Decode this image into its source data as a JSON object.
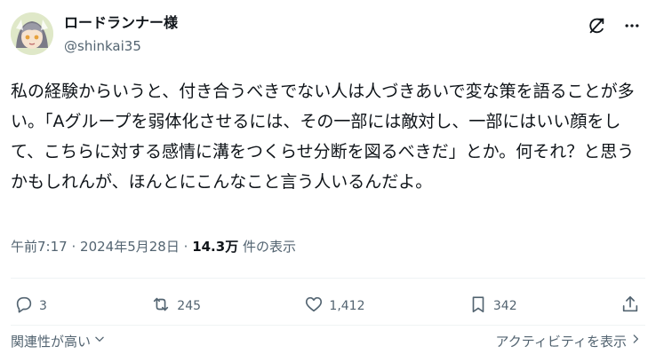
{
  "author": {
    "display_name": "ロードランナー様",
    "handle": "@shinkai35"
  },
  "icons": {
    "top_actions": [
      "grok-icon",
      "more-icon"
    ],
    "actions": [
      "reply-icon",
      "repost-icon",
      "like-icon",
      "bookmark-icon",
      "share-icon"
    ]
  },
  "post": {
    "text": "私の経験からいうと、付き合うべきでない人は人づきあいで変な策を語ることが多い。「Aグループを弱体化させるには、その一部には敵対し、一部にはいい顔をして、こちらに対する感情に溝をつくらせ分断を図るべきだ」とか。何それ？と思うかもしれんが、ほんとにこんなこと言う人いるんだよ。"
  },
  "meta": {
    "time": "午前7:17",
    "separator": "·",
    "date": "2024年5月28日",
    "views_count": "14.3万",
    "views_label": "件の表示"
  },
  "actions": {
    "replies": "3",
    "reposts": "245",
    "likes": "1,412",
    "bookmarks": "342"
  },
  "footer": {
    "sort_label": "関連性が高い",
    "activity_label": "アクティビティを表示"
  }
}
